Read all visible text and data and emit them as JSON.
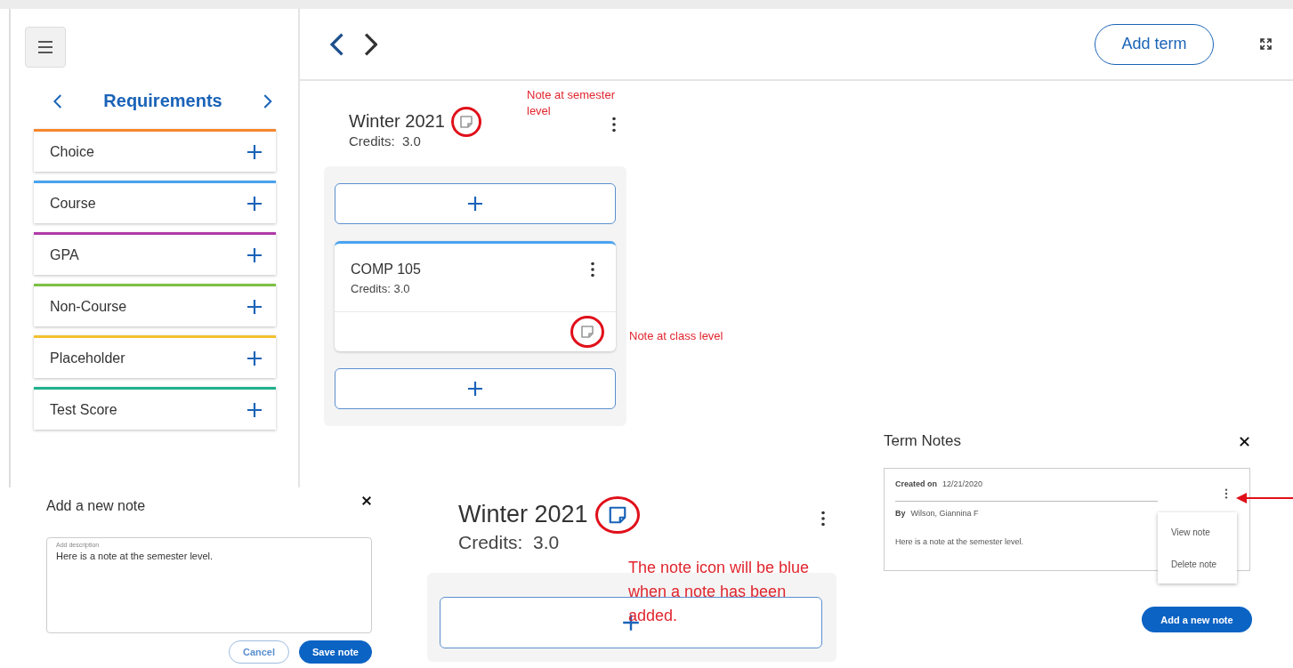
{
  "sidebar": {
    "title": "Requirements",
    "items": [
      {
        "label": "Choice",
        "color": "#f5862e"
      },
      {
        "label": "Course",
        "color": "#4aa3f0"
      },
      {
        "label": "GPA",
        "color": "#b03aa8"
      },
      {
        "label": "Non-Course",
        "color": "#7dc142"
      },
      {
        "label": "Placeholder",
        "color": "#f2c12e"
      },
      {
        "label": "Test Score",
        "color": "#1fb08c"
      }
    ]
  },
  "planner": {
    "add_button": "Add term",
    "term": {
      "name": "Winter 2021",
      "credits": "Credits:  3.0",
      "note_added": false,
      "courses": [
        {
          "code": "COMP 105",
          "credits": "Credits: 3.0",
          "note_added": false
        }
      ]
    }
  },
  "add_note_dialog": {
    "title": "Add a new note",
    "field_label": "Add description",
    "value": "Here is a note at the semester level.",
    "buttons": [
      "Cancel",
      "Save note"
    ]
  },
  "term_detail": {
    "name": "Winter 2021",
    "credits": "Credits:  3.0",
    "note_added": true
  },
  "term_notes": {
    "title": "Term Notes",
    "notes": [
      {
        "created_label": "Created on",
        "created": "12/21/2020",
        "by_label": "By",
        "author": "Wilson, Giannina F",
        "text": "Here is a note at the semester level."
      }
    ],
    "menu": [
      "View note",
      "Delete note"
    ],
    "add_button": "Add a new note"
  },
  "annotations": [
    {
      "text": "Note at semester level"
    },
    {
      "text": "Note at class level"
    },
    {
      "text": "The note icon will be blue when a note has been added."
    }
  ]
}
